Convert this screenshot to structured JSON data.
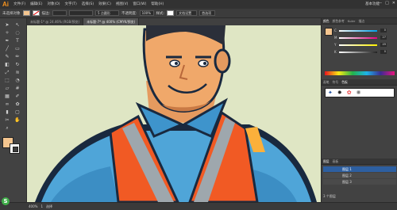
{
  "app": {
    "logo": "Ai",
    "workspace": "基本功能",
    "win_controls": [
      "—",
      "□",
      "✕"
    ]
  },
  "menus": [
    "文件(F)",
    "编辑(E)",
    "对象(O)",
    "文字(T)",
    "选择(S)",
    "效果(C)",
    "视图(V)",
    "窗口(W)",
    "帮助(H)"
  ],
  "control": {
    "selection": "未选择对象",
    "fill_color": "#f4c58f",
    "stroke_label": "描边:",
    "stroke_width": "",
    "brush": "5 点圆形",
    "opacity_label": "不透明度:",
    "opacity": "100%",
    "style_label": "样式:",
    "doc_setup": "文档设置",
    "prefs": "首选项"
  },
  "tabs": [
    {
      "label": "未标题-1* @ 24.46% (RGB/预览)",
      "active": false
    },
    {
      "label": "未标题-7* @ 400% (CMYK/预览)",
      "active": true
    }
  ],
  "tools": [
    "selection-icon",
    "direct-select-icon",
    "magic-wand-icon",
    "lasso-icon",
    "pen-icon",
    "type-icon",
    "line-icon",
    "rectangle-icon",
    "paintbrush-icon",
    "pencil-icon",
    "eraser-icon",
    "rotate-icon",
    "scale-icon",
    "width-icon",
    "free-transform-icon",
    "shape-builder-icon",
    "perspective-icon",
    "mesh-icon",
    "gradient-icon",
    "eyedropper-icon",
    "blend-icon",
    "symbol-sprayer-icon",
    "graph-icon",
    "artboard-icon",
    "slice-icon",
    "hand-icon",
    "zoom-icon"
  ],
  "color_panel": {
    "tabs": [
      "颜色",
      "颜色参考",
      "Kuler",
      "描边"
    ],
    "sliders": [
      {
        "label": "C",
        "value": "0",
        "color": "#00a0e9"
      },
      {
        "label": "M",
        "value": "27",
        "color": "#e4007f"
      },
      {
        "label": "Y",
        "value": "49",
        "color": "#fff100"
      },
      {
        "label": "K",
        "value": "0",
        "color": "#222222"
      }
    ]
  },
  "brush_panel": {
    "tabs": [
      "画笔",
      "符号",
      "色板"
    ]
  },
  "layers_panel": {
    "tabs": [
      "图层",
      "画板"
    ],
    "rows": [
      "图层 1",
      "图层 2",
      "图层 3"
    ],
    "count": "3 个图层"
  },
  "status": {
    "zoom": "400%",
    "page": "1",
    "tool": "选择"
  },
  "ime": "S"
}
